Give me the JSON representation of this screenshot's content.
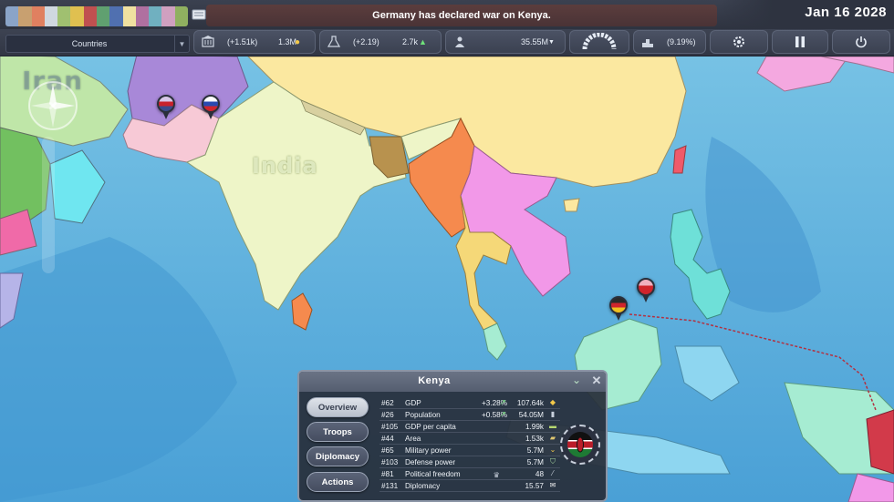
{
  "top_bar": {
    "news": "Germany has declared war on Kenya.",
    "date": "Jan 16 2028"
  },
  "stats_bar": {
    "country_select": {
      "value": "Countries"
    },
    "budget": {
      "change": "(+1.51k)",
      "value": "1.3M"
    },
    "research": {
      "change": "(+2.19)",
      "value": "2.7k"
    },
    "population": {
      "value": "35.55M"
    },
    "approval": {
      "value": "(9.19%)"
    }
  },
  "map": {
    "labels": {
      "iran": "Iran",
      "india": "India"
    }
  },
  "panel": {
    "title": "Kenya",
    "tabs": [
      {
        "label": "Overview",
        "active": true
      },
      {
        "label": "Troops",
        "active": false
      },
      {
        "label": "Diplomacy",
        "active": false
      },
      {
        "label": "Actions",
        "active": false
      }
    ],
    "stats": [
      {
        "rank": "#62",
        "name": "GDP",
        "change": "+3.28%",
        "value": "107.64k",
        "icon": "coins-icon"
      },
      {
        "rank": "#26",
        "name": "Population",
        "change": "+0.58%",
        "value": "54.05M",
        "icon": "people-icon"
      },
      {
        "rank": "#105",
        "name": "GDP per capita",
        "change": "",
        "value": "1.99k",
        "icon": "cash-icon"
      },
      {
        "rank": "#44",
        "name": "Area",
        "change": "",
        "value": "1.53k",
        "icon": "land-icon"
      },
      {
        "rank": "#65",
        "name": "Military power",
        "change": "",
        "value": "5.7M",
        "icon": "rank-icon"
      },
      {
        "rank": "#103",
        "name": "Defense power",
        "change": "",
        "value": "5.7M",
        "icon": "shield-icon"
      },
      {
        "rank": "#81",
        "name": "Political freedom",
        "change": "",
        "value": "48",
        "icon": "feather-icon"
      },
      {
        "rank": "#131",
        "name": "Diplomacy",
        "change": "",
        "value": "15.57",
        "icon": "handshake-icon"
      }
    ]
  },
  "colors": {
    "ocean": "#5fb0dc",
    "india": "#eef5c8",
    "china": "#fbe8a0",
    "myanmar": "#f58a4e",
    "indochina": "#f298e8",
    "bangladesh": "#b8924e",
    "pakistan": "#f7c9d6",
    "afghanistan": "#a888d8",
    "philippines": "#6ee0d8",
    "panel_bg": "#282e3a"
  }
}
